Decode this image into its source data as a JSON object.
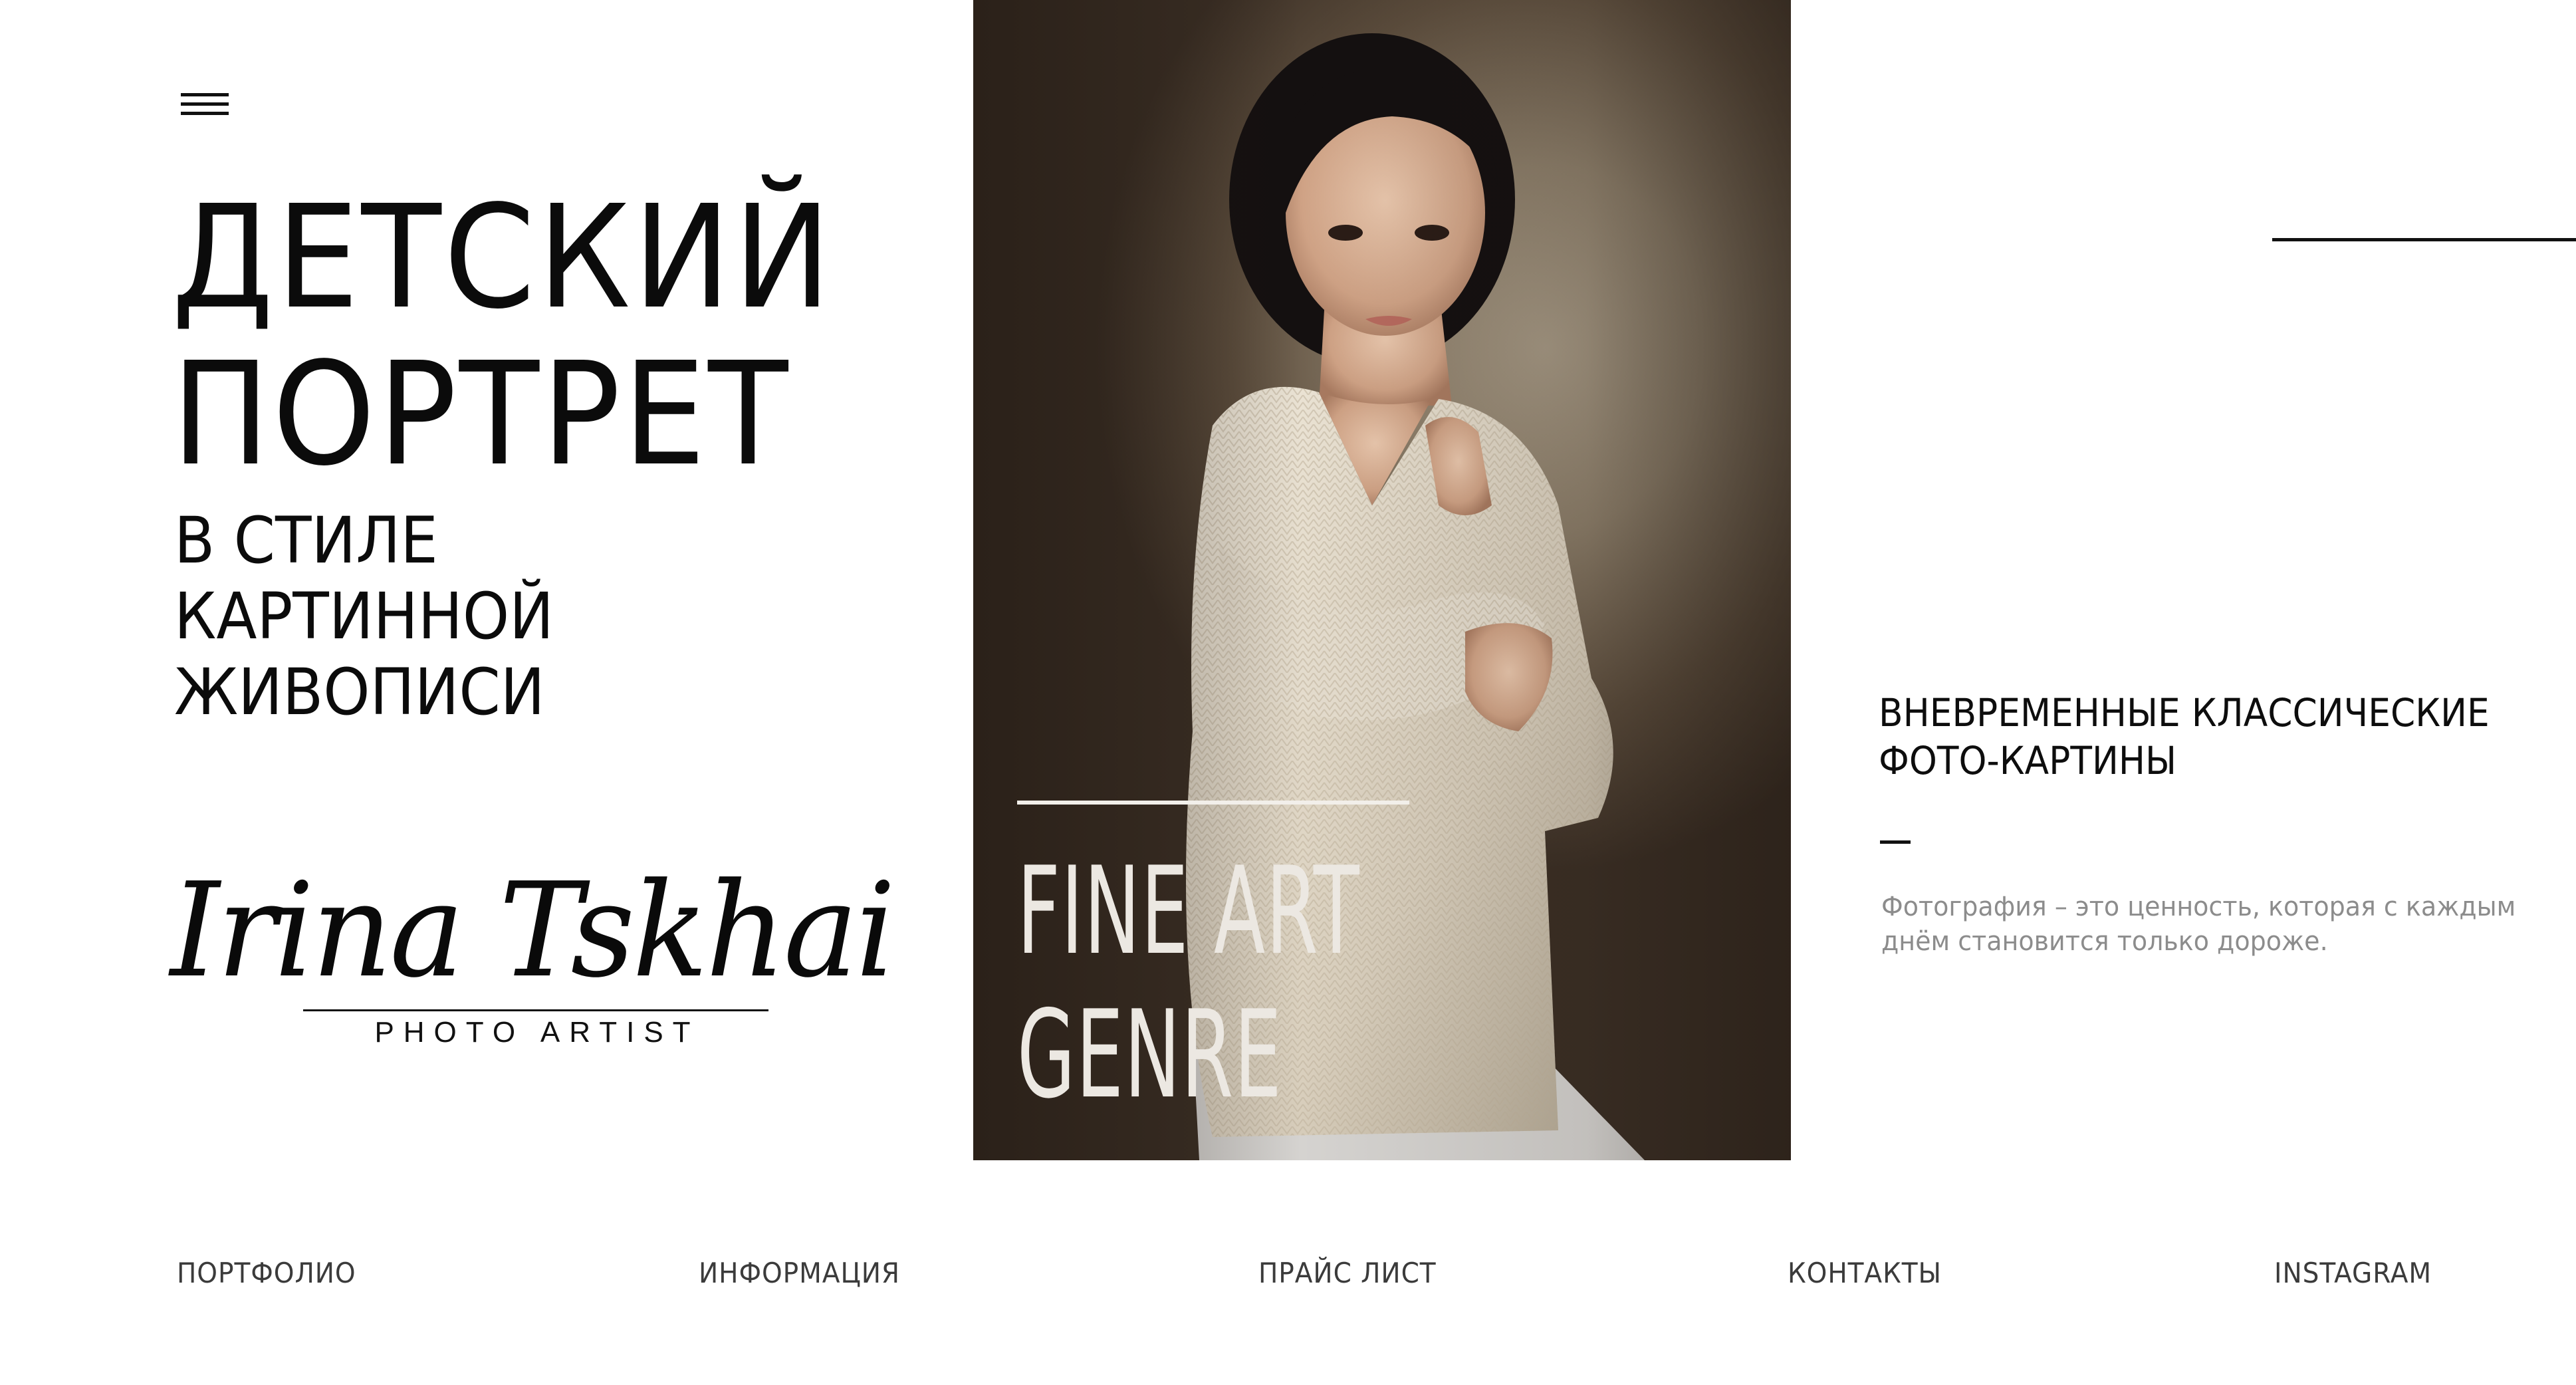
{
  "header": {
    "menu_icon": "hamburger-icon"
  },
  "hero": {
    "title_line1": "ДЕТСКИЙ",
    "title_line2": "ПОРТРЕТ",
    "subtitle_line1": "В СТИЛЕ",
    "subtitle_line2": "КАРТИННОЙ",
    "subtitle_line3": "ЖИВОПИСИ"
  },
  "logo": {
    "signature": "Irina Tskhai",
    "tagline": "PHOTO ARTIST"
  },
  "photo": {
    "overlay_line1": "FINE ART",
    "overlay_line2": "GENRE"
  },
  "aside": {
    "heading_line1": "ВНЕВРЕМЕННЫЕ КЛАССИЧЕСКИЕ",
    "heading_line2": "ФОТО-КАРТИНЫ",
    "quote_line1": "Фотография – это ценность, которая с каждым",
    "quote_line2": "днём становится только дороже."
  },
  "nav": {
    "items": [
      {
        "label": "ПОРТФОЛИО"
      },
      {
        "label": "ИНФОРМАЦИЯ"
      },
      {
        "label": "ПРАЙС ЛИСТ"
      },
      {
        "label": "КОНТАКТЫ"
      },
      {
        "label": "INSTAGRAM"
      }
    ]
  },
  "colors": {
    "text": "#111111",
    "muted": "#8c8c8c",
    "nav": "#3b3b3b",
    "background": "#ffffff",
    "overlay_text": "#ece8e2"
  }
}
